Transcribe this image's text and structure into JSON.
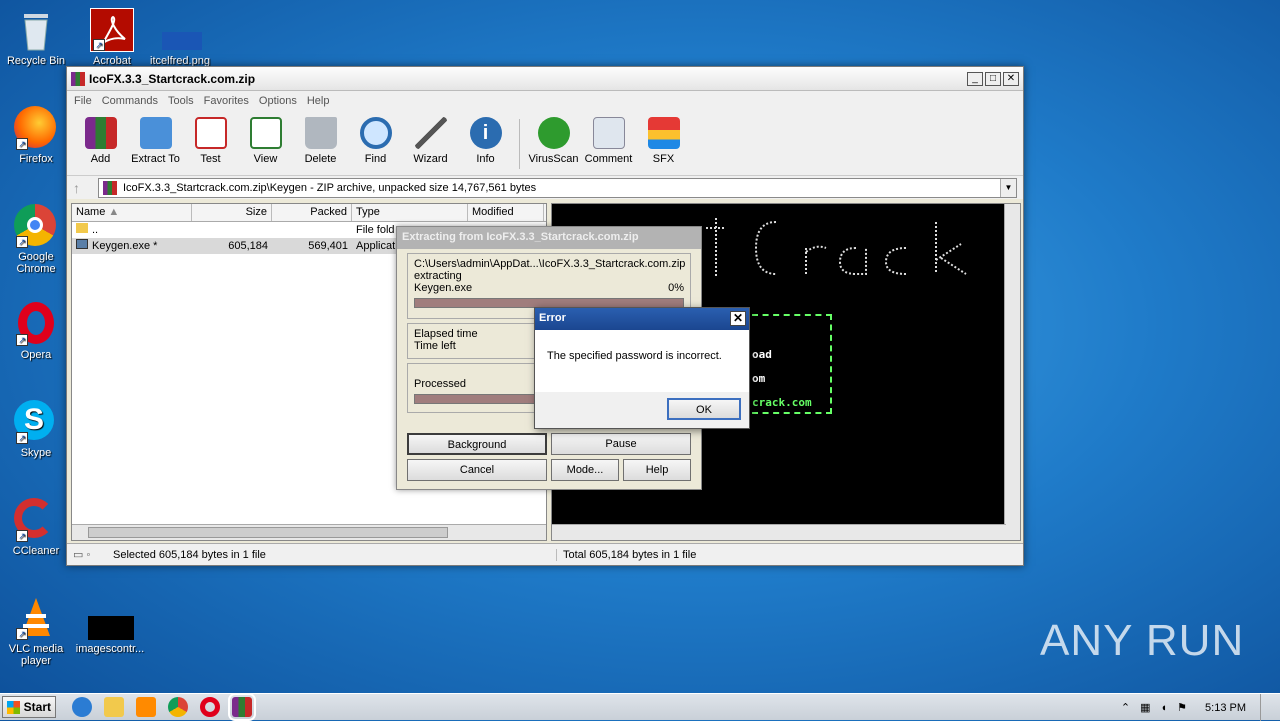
{
  "desktop": {
    "icons": [
      {
        "label": "Recycle Bin"
      },
      {
        "label": "Acrobat"
      },
      {
        "label": "itcelfred.png"
      },
      {
        "label": "Firefox"
      },
      {
        "label": "Google Chrome"
      },
      {
        "label": "Opera"
      },
      {
        "label": "Skype"
      },
      {
        "label": "CCleaner"
      },
      {
        "label": "VLC media player"
      },
      {
        "label": "imagescontr..."
      }
    ]
  },
  "winrar": {
    "title": "IcoFX.3.3_Startcrack.com.zip",
    "menu": [
      "File",
      "Commands",
      "Tools",
      "Favorites",
      "Options",
      "Help"
    ],
    "toolbar": [
      "Add",
      "Extract To",
      "Test",
      "View",
      "Delete",
      "Find",
      "Wizard",
      "Info",
      "VirusScan",
      "Comment",
      "SFX"
    ],
    "address": "IcoFX.3.3_Startcrack.com.zip\\Keygen - ZIP archive, unpacked size 14,767,561 bytes",
    "columns": [
      "Name",
      "Size",
      "Packed",
      "Type",
      "Modified"
    ],
    "rows": [
      {
        "name": "..",
        "size": "",
        "packed": "",
        "type": "File fold"
      },
      {
        "name": "Keygen.exe *",
        "size": "605,184",
        "packed": "569,401",
        "type": "Applicat"
      }
    ],
    "preview_lines": [
      "oad",
      "om",
      "crack.com"
    ],
    "status_left": "Selected 605,184 bytes in 1 file",
    "status_right": "Total 605,184 bytes in 1 file"
  },
  "extract_dialog": {
    "title": "Extracting from IcoFX.3.3_Startcrack.com.zip",
    "path": "C:\\Users\\admin\\AppDat...\\IcoFX.3.3_Startcrack.com.zip",
    "action": "extracting",
    "file": "Keygen.exe",
    "percent": "0%",
    "elapsed_label": "Elapsed time",
    "left_label": "Time left",
    "processed_label": "Processed",
    "buttons": {
      "background": "Background",
      "pause": "Pause",
      "cancel": "Cancel",
      "mode": "Mode...",
      "help": "Help"
    }
  },
  "error_dialog": {
    "title": "Error",
    "message": "The specified password is incorrect.",
    "ok": "OK"
  },
  "taskbar": {
    "start": "Start",
    "time": "5:13 PM"
  },
  "watermark": "ANY RUN"
}
